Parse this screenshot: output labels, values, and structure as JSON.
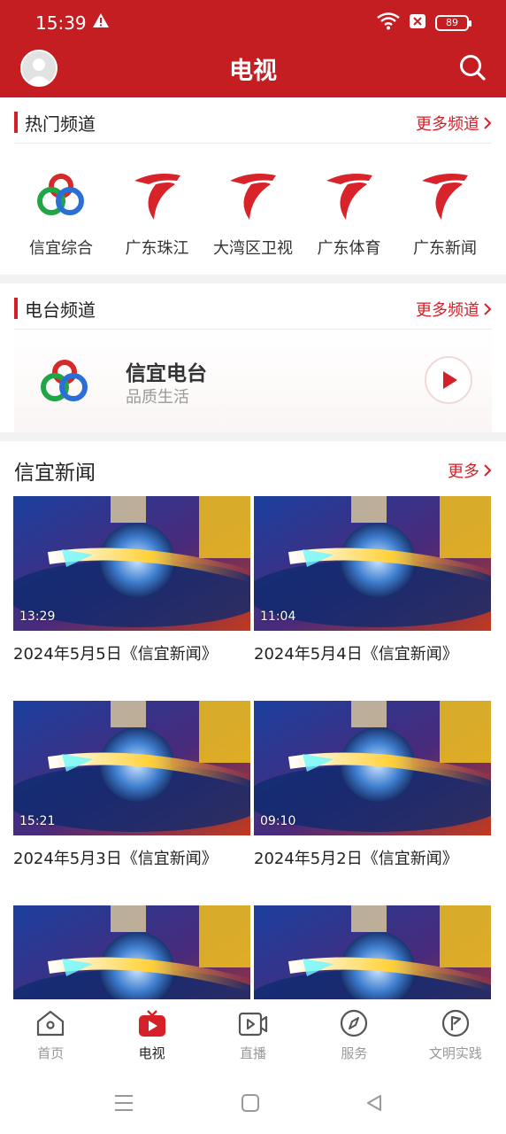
{
  "status": {
    "time": "15:39",
    "battery": "89"
  },
  "header": {
    "title": "电视"
  },
  "hot_channels": {
    "title": "热门频道",
    "more": "更多频道",
    "items": [
      {
        "name": "信宜综合",
        "logo": "xinyi-logo"
      },
      {
        "name": "广东珠江",
        "logo": "gdtv-logo"
      },
      {
        "name": "大湾区卫视",
        "logo": "gdtv-logo"
      },
      {
        "name": "广东体育",
        "logo": "gdtv-logo"
      },
      {
        "name": "广东新闻",
        "logo": "gdtv-logo"
      }
    ]
  },
  "radio_channels": {
    "title": "电台频道",
    "more": "更多频道",
    "station": {
      "name": "信宜电台",
      "subtitle": "品质生活"
    }
  },
  "news": {
    "title": "信宜新闻",
    "more": "更多",
    "items": [
      {
        "duration": "13:29",
        "caption": "2024年5月5日《信宜新闻》"
      },
      {
        "duration": "11:04",
        "caption": "2024年5月4日《信宜新闻》"
      },
      {
        "duration": "15:21",
        "caption": "2024年5月3日《信宜新闻》"
      },
      {
        "duration": "09:10",
        "caption": "2024年5月2日《信宜新闻》"
      },
      {
        "duration": "",
        "caption": ""
      },
      {
        "duration": "",
        "caption": ""
      }
    ]
  },
  "tabs": [
    {
      "label": "首页",
      "icon": "home-icon",
      "active": false
    },
    {
      "label": "电视",
      "icon": "tv-icon",
      "active": true
    },
    {
      "label": "直播",
      "icon": "live-video-icon",
      "active": false
    },
    {
      "label": "服务",
      "icon": "compass-icon",
      "active": false
    },
    {
      "label": "文明实践",
      "icon": "flag-icon",
      "active": false
    }
  ],
  "colors": {
    "brand_red": "#c41e23",
    "accent_red": "#d5202a",
    "muted_text": "#999999"
  }
}
